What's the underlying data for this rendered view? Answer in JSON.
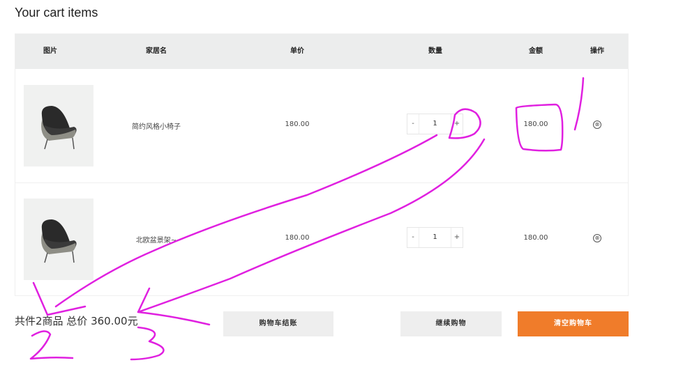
{
  "page": {
    "title": "Your cart items"
  },
  "cart": {
    "headers": [
      "图片",
      "家居名",
      "单价",
      "数量",
      "金额",
      "操作"
    ],
    "rows": [
      {
        "name": "简约风格小椅子",
        "price": "180.00",
        "quantity": "1",
        "minus": "-",
        "plus": "+",
        "amount": "180.00",
        "remove_icon": "⊗"
      },
      {
        "name": "北欧盆景架~",
        "price": "180.00",
        "quantity": "1",
        "minus": "-",
        "plus": "+",
        "amount": "180.00",
        "remove_icon": "⊗"
      }
    ]
  },
  "summary": {
    "text": "共件2商品 总价 360.00元"
  },
  "actions": {
    "checkout": "购物车结账",
    "continue": "继续购物",
    "clear": "清空购物车"
  },
  "annotations": {
    "color": "#e020e0"
  },
  "colors": {
    "header_bg": "#eceded",
    "clear_button": "#f07c2a",
    "thumb_bg": "#f0f1f0"
  }
}
